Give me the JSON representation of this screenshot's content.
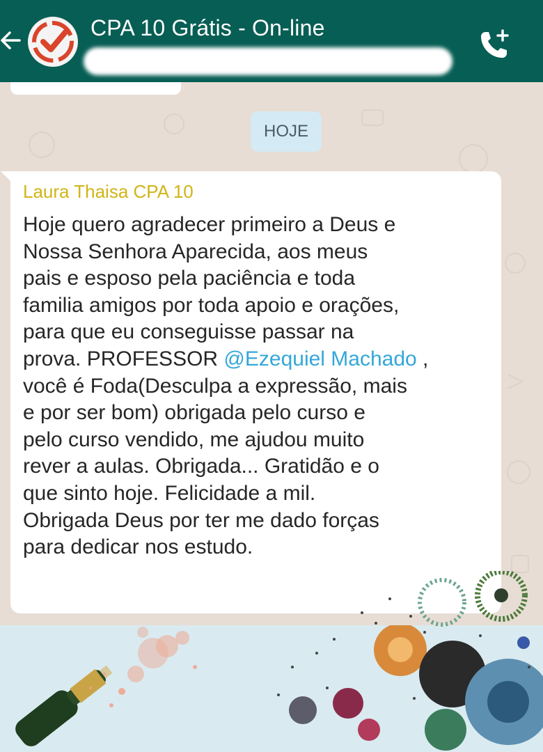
{
  "header": {
    "title": "CPA 10 Grátis - On-line",
    "icons": {
      "back": "arrow-left-icon",
      "avatar": "checkmark-logo",
      "call": "add-call-icon"
    },
    "colors": {
      "bar": "#075e54",
      "text": "#ffffff"
    }
  },
  "chat": {
    "day_divider": "HOJE",
    "message": {
      "sender": "Laura Thaisa CPA 10",
      "text_before_mention": "Hoje quero agradecer primeiro a Deus e\nNossa Senhora Aparecida, aos meus\npais e esposo pela paciência e toda\nfamilia amigos por toda apoio e orações,\npara que eu conseguisse passar na\nprova. PROFESSOR ",
      "mention": "@Ezequiel Machado",
      "text_after_mention": " ,\nvocê é Foda(Desculpa a expressão, mais\ne por ser bom) obrigada pelo curso e\npelo curso vendido, me ajudou muito\nrever a aulas. Obrigada... Gratidão e o\nque sinto hoje. Felicidade a mil.\nObrigada Deus por ter me dado forças\npara dedicar nos estudo."
    },
    "colors": {
      "sender": "#d2b417",
      "mention": "#34a7d8",
      "background": "#e7ddd4"
    }
  }
}
